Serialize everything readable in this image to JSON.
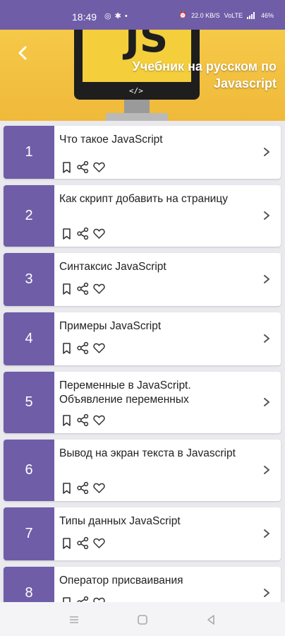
{
  "status_bar": {
    "time": "18:49",
    "left_icons": [
      "whatsapp-icon",
      "gear-icon",
      "dot-icon"
    ],
    "right_text": [
      "22.0 KB/S",
      "VoLTE",
      "46%"
    ]
  },
  "header": {
    "title": "Учебник на русском по Javascript",
    "image_code": "</>",
    "image_logo": "JS"
  },
  "lessons": [
    {
      "number": "1",
      "title": "Что такое JavaScript"
    },
    {
      "number": "2",
      "title": "Как скрипт добавить на страницу"
    },
    {
      "number": "3",
      "title": "Синтаксис JavaScript"
    },
    {
      "number": "4",
      "title": "Примеры JavaScript"
    },
    {
      "number": "5",
      "title": "Переменные в JavaScript. Объявление переменных"
    },
    {
      "number": "6",
      "title": "Вывод на экран текста в Javascript"
    },
    {
      "number": "7",
      "title": "Типы данных JavaScript"
    },
    {
      "number": "8",
      "title": "Оператор присваивания"
    }
  ],
  "icons": {
    "bookmark": "bookmark-icon",
    "share": "share-icon",
    "favorite": "heart-icon",
    "open": "chevron-right-icon"
  },
  "colors": {
    "accent": "#6f5da8",
    "header": "#f6c948",
    "background": "#e9e9ee"
  }
}
